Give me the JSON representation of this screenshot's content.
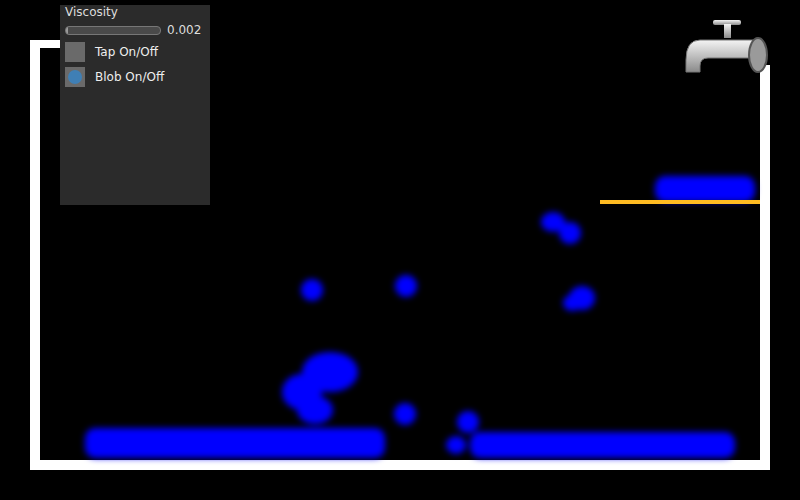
{
  "panel": {
    "slider": {
      "label": "Viscosity",
      "value": "0.002",
      "level": 0.02
    },
    "toggles": [
      {
        "label": "Tap On/Off",
        "checked": false
      },
      {
        "label": "Blob On/Off",
        "checked": true
      }
    ]
  }
}
